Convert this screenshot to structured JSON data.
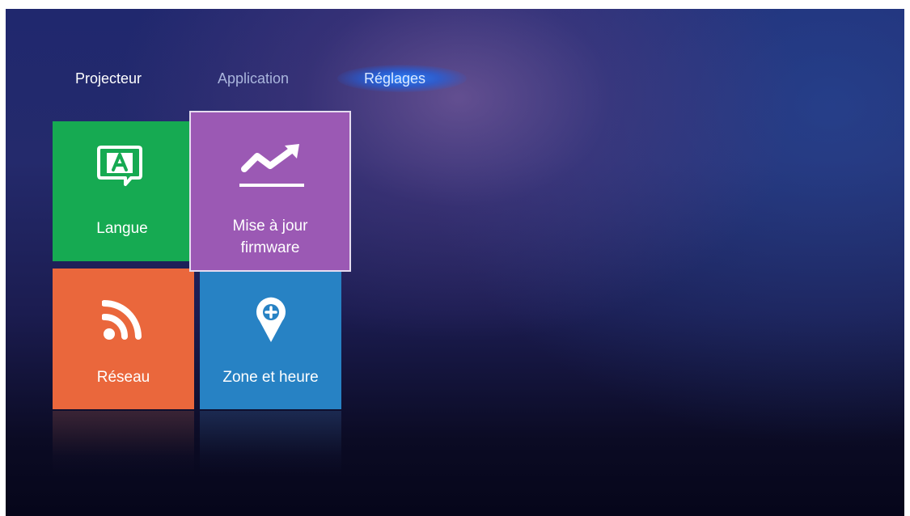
{
  "nav": {
    "tabs": [
      {
        "label": "Projecteur"
      },
      {
        "label": "Application"
      },
      {
        "label": "Réglages"
      }
    ],
    "active_tab": "Réglages"
  },
  "tiles": [
    {
      "label": "Langue",
      "icon": "language-icon",
      "color": "#16aa52"
    },
    {
      "label_line1": "Mise à jour",
      "label_line2": "firmware",
      "icon": "trending-up-icon",
      "color": "#9b59b4",
      "selected": true
    },
    {
      "label": "Réseau",
      "icon": "rss-icon",
      "color": "#ea673c"
    },
    {
      "label": "Zone et heure",
      "icon": "map-pin-icon",
      "color": "#2782c4"
    }
  ],
  "theme": {
    "background": "#20286e",
    "active_glow": "#2882ff"
  }
}
